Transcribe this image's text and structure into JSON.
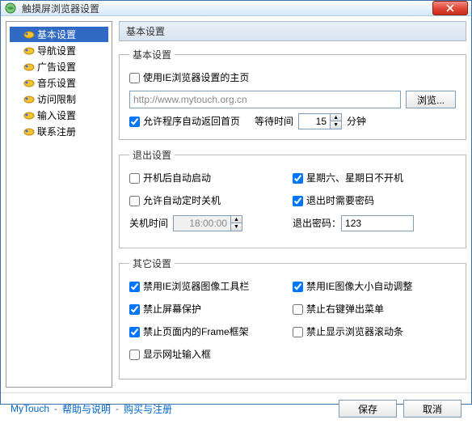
{
  "window": {
    "title": "触摸屏浏览器设置"
  },
  "nav": {
    "items": [
      {
        "label": "基本设置",
        "selected": true
      },
      {
        "label": "导航设置"
      },
      {
        "label": "广告设置"
      },
      {
        "label": "音乐设置"
      },
      {
        "label": "访问限制"
      },
      {
        "label": "输入设置"
      },
      {
        "label": "联系注册"
      }
    ]
  },
  "content": {
    "title": "基本设置",
    "basic": {
      "legend": "基本设置",
      "use_ie_homepage": "使用IE浏览器设置的主页",
      "url": "http://www.mytouch.org.cn",
      "browse": "浏览...",
      "auto_return": "允许程序自动返回首页",
      "wait_label": "等待时间",
      "wait_value": "15",
      "wait_unit": "分钟"
    },
    "exit": {
      "legend": "退出设置",
      "autostart": "开机后自动启动",
      "auto_shutdown": "允许自动定时关机",
      "shutdown_time_label": "关机时间",
      "shutdown_time": "18:00:00",
      "weekend_off": "星期六、星期日不开机",
      "need_password": "退出时需要密码",
      "exit_pwd_label": "退出密码：",
      "exit_pwd": "123"
    },
    "other": {
      "legend": "其它设置",
      "disable_ie_toolbar": "禁用IE浏览器图像工具栏",
      "disable_screensaver": "禁止屏幕保护",
      "disable_frame": "禁止页面内的Frame框架",
      "show_url_input": "显示网址输入框",
      "disable_ie_autosize": "禁用IE图像大小自动调整",
      "disable_rightclick": "禁止右键弹出菜单",
      "disable_scrollbar": "禁止显示浏览器滚动条"
    }
  },
  "footer": {
    "brand": "MyTouch",
    "help": "帮助与说明",
    "buy": "购买与注册",
    "save": "保存",
    "cancel": "取消"
  },
  "colors": {
    "accent": "#316ac5",
    "link": "#0066cc"
  }
}
